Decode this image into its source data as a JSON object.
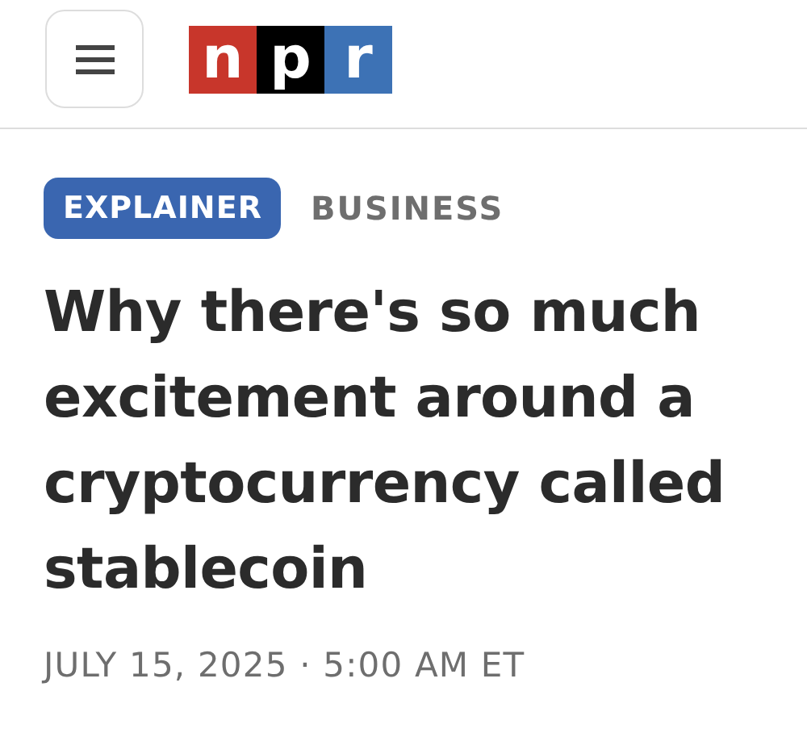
{
  "header": {
    "logo": [
      {
        "letter": "n",
        "color": "#c8362b"
      },
      {
        "letter": "p",
        "color": "#000000"
      },
      {
        "letter": "r",
        "color": "#3d72b5"
      }
    ]
  },
  "article": {
    "label": "EXPLAINER",
    "section": "BUSINESS",
    "headline": "Why there's so much excitement around a cryptocurrency called stablecoin",
    "date": "JULY 15, 2025 · 5:00 AM ET"
  }
}
